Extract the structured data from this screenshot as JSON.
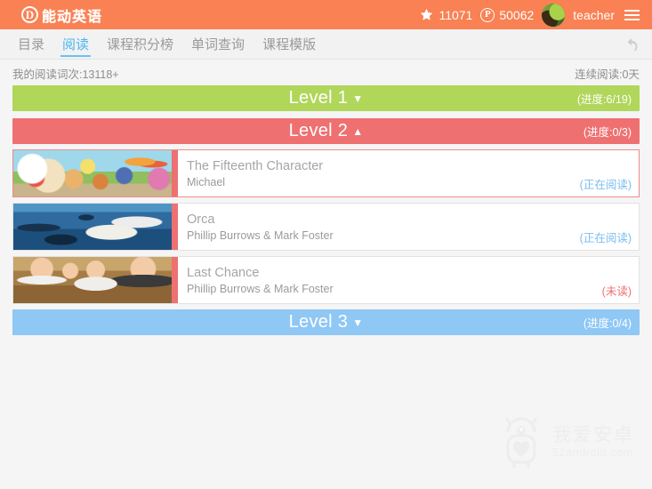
{
  "header": {
    "logo_badge": "D",
    "logo_text": "能动英语",
    "star_icon": "star-icon",
    "star_count": "11071",
    "point_icon": "P",
    "point_count": "50062",
    "avatar": "user-avatar",
    "username": "teacher",
    "menu_icon": "hamburger-menu-icon"
  },
  "nav": {
    "items": [
      {
        "label": "目录",
        "active": false
      },
      {
        "label": "阅读",
        "active": true
      },
      {
        "label": "课程积分榜",
        "active": false
      },
      {
        "label": "单词查询",
        "active": false
      },
      {
        "label": "课程模版",
        "active": false
      }
    ],
    "back_icon": "back-arrow-icon"
  },
  "stats": {
    "reading_words": "我的阅读词次:13118+",
    "streak": "连续阅读:0天"
  },
  "levels": [
    {
      "title": "Level 1",
      "caret": "▼",
      "expanded": false,
      "progress": "(进度:6/19)",
      "color": "#b0d65a"
    },
    {
      "title": "Level 2",
      "caret": "▲",
      "expanded": true,
      "progress": "(进度:0/3)",
      "color": "#ee7070"
    },
    {
      "title": "Level 3",
      "caret": "▼",
      "expanded": false,
      "progress": "(进度:0/4)",
      "color": "#8fc7f5"
    }
  ],
  "books": [
    {
      "title": "The Fifteenth Character",
      "author": "Michael",
      "status": "(正在阅读)",
      "status_type": "reading",
      "thumb": "carnival-fair-illustration",
      "selected": true
    },
    {
      "title": "Orca",
      "author": "Phillip Burrows & Mark Foster",
      "status": "(正在阅读)",
      "status_type": "reading",
      "thumb": "ocean-orca-boat-illustration",
      "selected": false
    },
    {
      "title": "Last Chance",
      "author": "Phillip Burrows & Mark Foster",
      "status": "(未读)",
      "status_type": "unread",
      "thumb": "classroom-people-illustration",
      "selected": false
    }
  ],
  "watermark": {
    "logo": "android-robot-icon",
    "text_cn": "我爱安卓",
    "text_en": "52android.com"
  },
  "colors": {
    "header_orange": "#f98153",
    "level1_green": "#b0d65a",
    "level2_red": "#ee7070",
    "level3_blue": "#8fc7f5",
    "accent_blue": "#69c3f2",
    "page_background": "#f5f5f5"
  }
}
